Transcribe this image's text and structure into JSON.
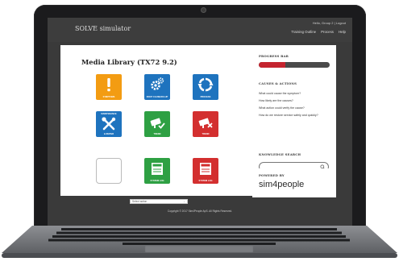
{
  "app": {
    "title": "SOLVE simulator",
    "user_info": "Hello, Group 2 | Logout",
    "nav": [
      "Training Outline",
      "Process",
      "Help"
    ]
  },
  "library": {
    "title": "Media Library (TX72 9.2)",
    "tiles": [
      {
        "label": "SYMPTOMS",
        "label_pos": "bottom",
        "color": "#f39c12",
        "icon": "exclamation-icon"
      },
      {
        "label": "ROOT CAUSE/FIX-UP",
        "label_pos": "bottom",
        "color": "#1e73be",
        "icon": "gears-icon"
      },
      {
        "label": "PROCESS",
        "label_pos": "bottom",
        "color": "#1e73be",
        "icon": "process-cycle-icon"
      },
      {
        "label": "MAINTENANCE & REPAIR",
        "label_pos": "top-bottom",
        "label_top": "MAINTENANCE",
        "label_bottom": "& REPAIR",
        "color": "#1e73be",
        "icon": "wrench-screwdriver-icon"
      },
      {
        "label": "TREND",
        "label_pos": "bottom",
        "color": "#2ea043",
        "icon": "camera-check-icon"
      },
      {
        "label": "TREND",
        "label_pos": "bottom",
        "color": "#d32f2f",
        "icon": "camera-cross-icon"
      },
      {
        "label": "",
        "label_pos": "none",
        "color": "#ffffff",
        "icon": ""
      },
      {
        "label": "REPORT SYSTEM LOG",
        "label_pos": "top-bottom",
        "label_top": "REPORT",
        "label_bottom": "SYSTEM LOG",
        "color": "#2ea043",
        "icon": "document-icon"
      },
      {
        "label": "NOTES SYSTEM LOG",
        "label_pos": "top-bottom",
        "label_top": "NOTES",
        "label_bottom": "SYSTEM LOG",
        "color": "#d32f2f",
        "icon": "document-icon"
      }
    ],
    "select_action": "Select action"
  },
  "progress": {
    "heading": "PROGRESS BAR",
    "value": 0.38,
    "color": "#c4242f"
  },
  "causes": {
    "heading": "CAUSES & ACTIONS",
    "items": [
      "What could cause the symptom?",
      "How likely are the causes?",
      "What action could verify the cause?",
      "How do we restore service safely and quickly?"
    ]
  },
  "knowledge": {
    "heading": "KNOWLEDGE SEARCH",
    "placeholder": ""
  },
  "powered": {
    "heading": "POWERED BY",
    "brand": "sim4people"
  },
  "footer": {
    "copyright": "Copyright © 2017 Sim4People ApS. All Rights Reserved."
  }
}
